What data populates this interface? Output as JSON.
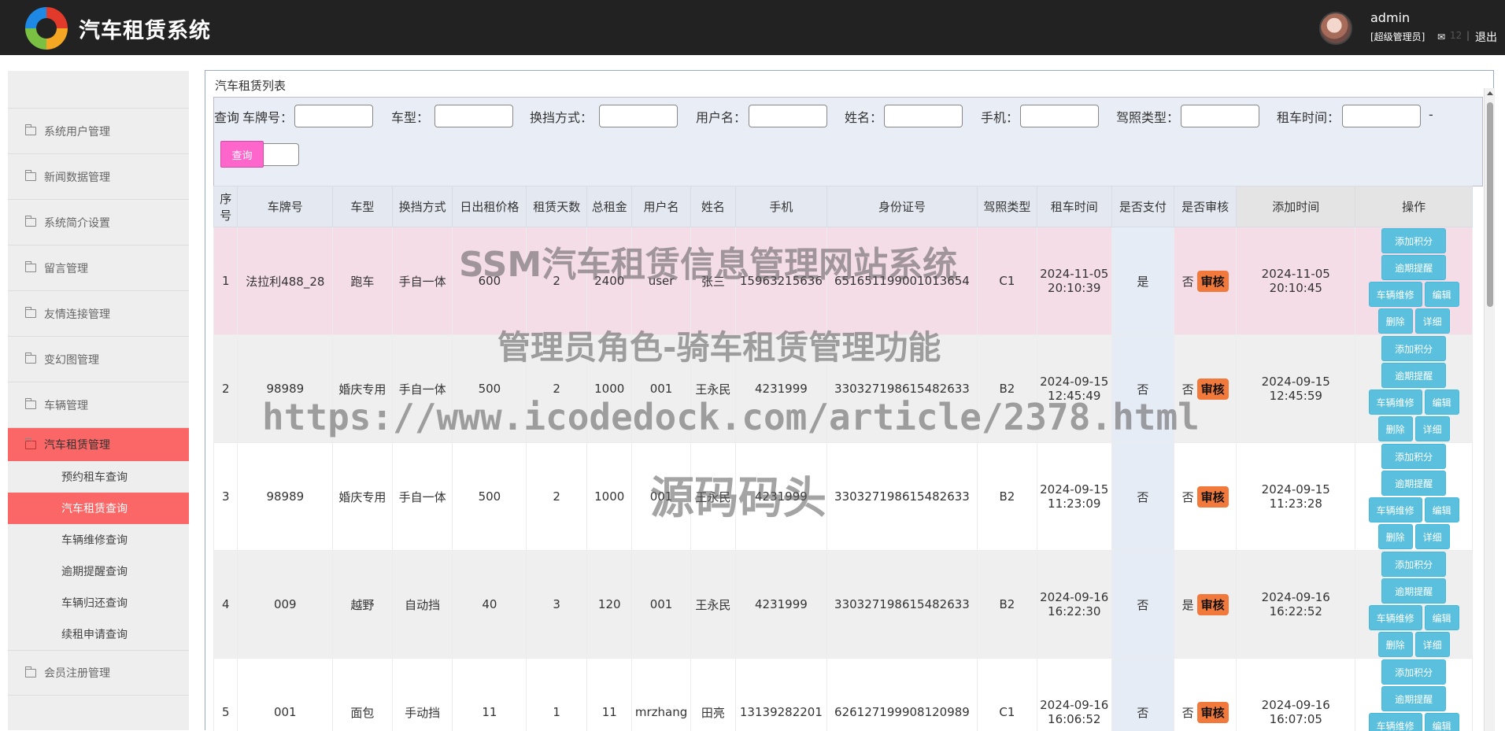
{
  "header": {
    "app_title": "汽车租赁系统",
    "user_name": "admin",
    "user_role": "[超级管理员]",
    "mail_count": "12",
    "separator": "|",
    "logout": "退出"
  },
  "sidebar": {
    "items": [
      {
        "label": "系统用户管理"
      },
      {
        "label": "新闻数据管理"
      },
      {
        "label": "系统简介设置"
      },
      {
        "label": "留言管理"
      },
      {
        "label": "友情连接管理"
      },
      {
        "label": "变幻图管理"
      },
      {
        "label": "车辆管理"
      },
      {
        "label": "汽车租赁管理"
      }
    ],
    "subitems": [
      {
        "label": "预约租车查询"
      },
      {
        "label": "汽车租赁查询"
      },
      {
        "label": "车辆维修查询"
      },
      {
        "label": "逾期提醒查询"
      },
      {
        "label": "车辆归还查询"
      },
      {
        "label": "续租申请查询"
      }
    ],
    "last_item": {
      "label": "会员注册管理"
    }
  },
  "panel": {
    "title": "汽车租赁列表"
  },
  "search": {
    "prefix": "查询",
    "fields": [
      "车牌号：",
      "车型：",
      "换挡方式：",
      "用户名：",
      "姓名：",
      "手机：",
      "驾照类型：",
      "租车时间："
    ],
    "range_sep": "-",
    "button": "查询"
  },
  "table": {
    "headers": [
      "序号",
      "车牌号",
      "车型",
      "换挡方式",
      "日出租价格",
      "租赁天数",
      "总租金",
      "用户名",
      "姓名",
      "手机",
      "身份证号",
      "驾照类型",
      "租车时间",
      "是否支付",
      "是否审核",
      "添加时间",
      "操作"
    ],
    "audit_label": "审核",
    "ops": {
      "add_points": "添加积分",
      "overdue": "逾期提醒",
      "repair": "车辆维修",
      "edit": "编辑",
      "delete": "删除",
      "detail": "详细"
    },
    "rows": [
      {
        "no": "1",
        "plate": "法拉利488_28",
        "model": "跑车",
        "gear": "手自一体",
        "price": "600",
        "days": "2",
        "total": "2400",
        "username": "user",
        "name": "张三",
        "phone": "15963215636",
        "idcard": "651651199001013654",
        "license": "C1",
        "rent_date": "2024-11-05",
        "rent_time": "20:10:39",
        "paid": "是",
        "audited": "否",
        "added": "2024-11-05 20:10:45"
      },
      {
        "no": "2",
        "plate": "98989",
        "model": "婚庆专用",
        "gear": "手自一体",
        "price": "500",
        "days": "2",
        "total": "1000",
        "username": "001",
        "name": "王永民",
        "phone": "4231999",
        "idcard": "330327198615482633",
        "license": "B2",
        "rent_date": "2024-09-15",
        "rent_time": "12:45:49",
        "paid": "否",
        "audited": "否",
        "added": "2024-09-15 12:45:59"
      },
      {
        "no": "3",
        "plate": "98989",
        "model": "婚庆专用",
        "gear": "手自一体",
        "price": "500",
        "days": "2",
        "total": "1000",
        "username": "001",
        "name": "王永民",
        "phone": "4231999",
        "idcard": "330327198615482633",
        "license": "B2",
        "rent_date": "2024-09-15",
        "rent_time": "11:23:09",
        "paid": "否",
        "audited": "否",
        "added": "2024-09-15 11:23:28"
      },
      {
        "no": "4",
        "plate": "009",
        "model": "越野",
        "gear": "自动挡",
        "price": "40",
        "days": "3",
        "total": "120",
        "username": "001",
        "name": "王永民",
        "phone": "4231999",
        "idcard": "330327198615482633",
        "license": "B2",
        "rent_date": "2024-09-16",
        "rent_time": "16:22:30",
        "paid": "否",
        "audited": "是",
        "added": "2024-09-16 16:22:52"
      },
      {
        "no": "5",
        "plate": "001",
        "model": "面包",
        "gear": "手动挡",
        "price": "11",
        "days": "1",
        "total": "11",
        "username": "mrzhang",
        "name": "田亮",
        "phone": "13139282201",
        "idcard": "626127199908120989",
        "license": "C1",
        "rent_date": "2024-09-16",
        "rent_time": "16:06:52",
        "paid": "否",
        "audited": "否",
        "added": "2024-09-16 16:07:05"
      }
    ]
  },
  "watermark": {
    "line1": "SSM汽车租赁信息管理网站系统",
    "line2": "管理员角色-骑车租赁管理功能",
    "line3": "https://www.icodedock.com/article/2378.html",
    "line4": "源码码头"
  }
}
